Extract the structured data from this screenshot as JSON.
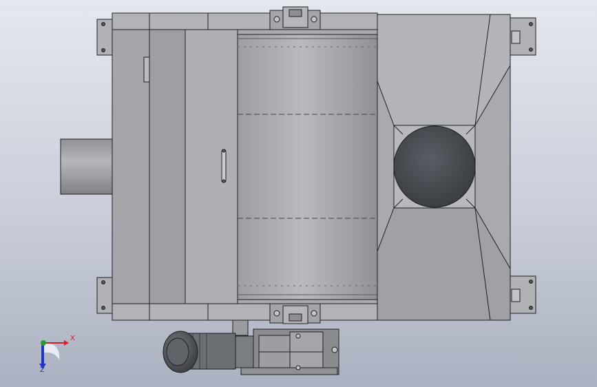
{
  "triad": {
    "x_label": "X",
    "z_label": "Z"
  },
  "colors": {
    "body_fill": "#a9abae",
    "edge": "#1f1f1f",
    "drum_light": "#b9bbbf",
    "drum_dark": "#8c8e92",
    "opening": "#4a4d52",
    "axis_x": "#d42020",
    "axis_y": "#22a02a",
    "axis_z": "#2233c8"
  }
}
